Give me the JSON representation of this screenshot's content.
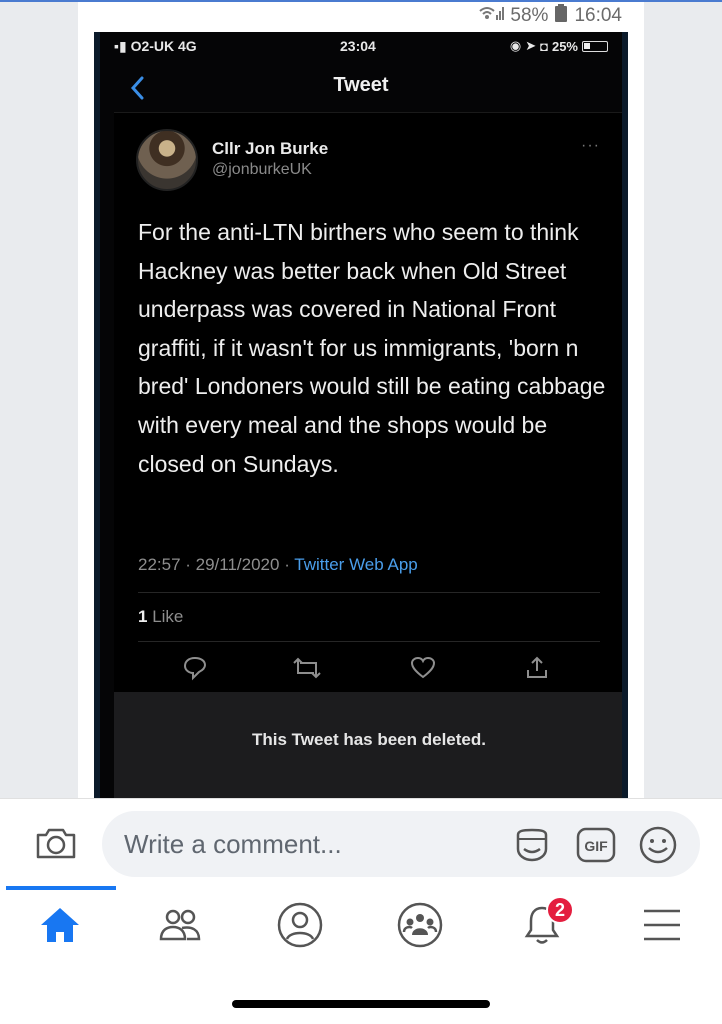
{
  "outer_status": {
    "battery": "58%",
    "time": "16:04"
  },
  "phone_status": {
    "carrier": "O2-UK 4G",
    "time": "23:04",
    "battery": "25%"
  },
  "header": {
    "title": "Tweet",
    "back_icon": "chevron-left-icon"
  },
  "tweet": {
    "author_name": "Cllr Jon Burke",
    "author_handle": "@jonburkeUK",
    "more": "···",
    "text": "For the anti-LTN birthers who seem to think Hackney was better back when Old Street underpass was covered in National Front graffiti, if it wasn't for us immigrants, 'born n bred' Londoners would still be eating cabbage with every meal and the shops would be closed on Sundays.",
    "timestamp": "22:57 · 29/11/2020 · ",
    "source": "Twitter Web App",
    "like_count": "1",
    "like_label": " Like",
    "actions": [
      "reply-icon",
      "retweet-icon",
      "like-icon",
      "share-icon"
    ]
  },
  "deleted_notice": "This Tweet has been deleted.",
  "comment_bar": {
    "placeholder": "Write a comment...",
    "icons": [
      "camera-icon",
      "sticker-icon",
      "gif-icon",
      "emoji-icon"
    ]
  },
  "nav": {
    "items": [
      "home-icon",
      "friends-icon",
      "profile-icon",
      "groups-icon",
      "notifications-icon",
      "menu-icon"
    ],
    "notification_badge": "2",
    "active_color": "#1877f2"
  },
  "colors": {
    "link": "#4a9eeb",
    "badge": "#e41e3f",
    "accent": "#1877f2"
  }
}
